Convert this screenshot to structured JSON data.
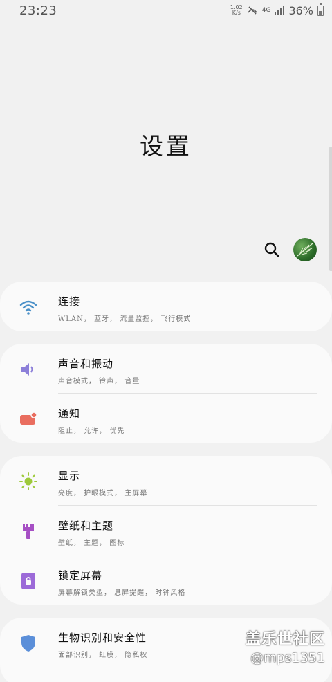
{
  "status_bar": {
    "time": "23:23",
    "net_speed_value": "1.02",
    "net_speed_unit": "K/s",
    "network_type": "4G",
    "battery": "36%"
  },
  "header": {
    "title": "设置"
  },
  "cards": [
    {
      "items": [
        {
          "title": "连接",
          "subtitle": "WLAN， 蓝牙， 流量监控， 飞行模式",
          "icon": "wifi-icon",
          "color": "#4a90c8"
        }
      ]
    },
    {
      "items": [
        {
          "title": "声音和振动",
          "subtitle": "声音模式， 铃声， 音量",
          "icon": "volume-icon",
          "color": "#8c7fd9"
        },
        {
          "title": "通知",
          "subtitle": "阻止， 允许， 优先",
          "icon": "notification-icon",
          "color": "#e96d5f"
        }
      ]
    },
    {
      "items": [
        {
          "title": "显示",
          "subtitle": "亮度， 护眼模式， 主屏幕",
          "icon": "brightness-icon",
          "color": "#9dc93a"
        },
        {
          "title": "壁纸和主题",
          "subtitle": "壁纸， 主题， 图标",
          "icon": "paint-brush-icon",
          "color": "#a64fc4"
        },
        {
          "title": "锁定屏幕",
          "subtitle": "屏幕解锁类型， 息屏提醒， 时钟风格",
          "icon": "lock-icon",
          "color": "#9c6ad8"
        }
      ]
    },
    {
      "items": [
        {
          "title": "生物识别和安全性",
          "subtitle": "面部识别， 虹膜， 隐私权",
          "icon": "shield-icon",
          "color": "#5b8fd9"
        }
      ]
    }
  ],
  "watermark": {
    "brand": "盖乐世社区",
    "handle": "@mps1351"
  }
}
